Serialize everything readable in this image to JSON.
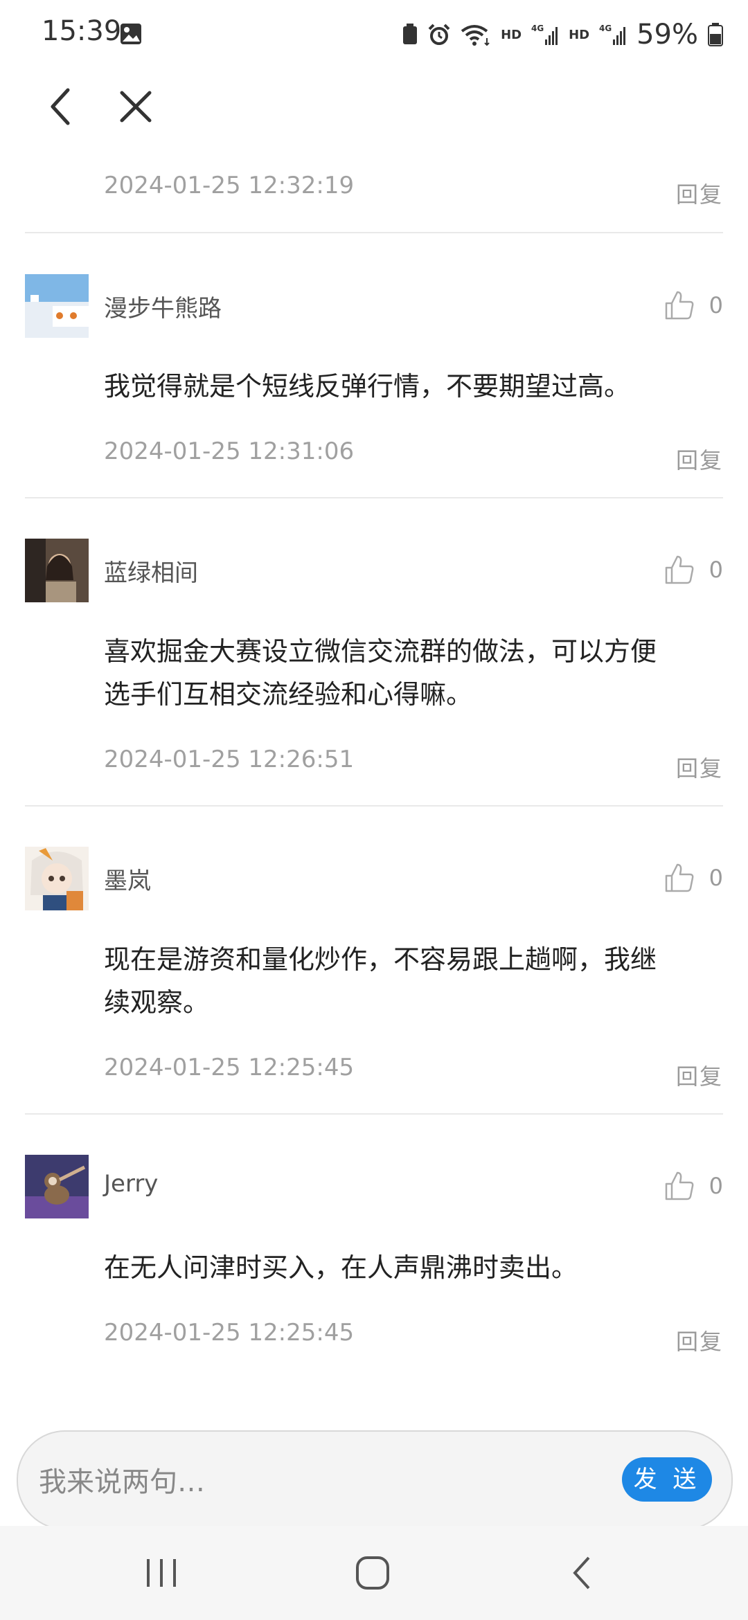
{
  "status_bar": {
    "time": "15:39",
    "battery": "59%",
    "signal_hd_1": "HD",
    "signal_4g_1": "4G",
    "signal_hd_2": "HD",
    "signal_4g_2": "4G",
    "wifi_sub": "6"
  },
  "nav": {
    "back_icon": "back-icon",
    "close_icon": "close-icon"
  },
  "top_partial": {
    "timestamp": "2024-01-25 12:32:19",
    "reply": "回复"
  },
  "comments": [
    {
      "username": "漫步牛熊路",
      "likes": "0",
      "lines": [
        "我觉得就是个短线反弹行情，不要期望过高。"
      ],
      "timestamp": "2024-01-25 12:31:06",
      "reply": "回复"
    },
    {
      "username": "蓝绿相间",
      "likes": "0",
      "lines": [
        "喜欢掘金大赛设立微信交流群的做法，可以方便",
        "选手们互相交流经验和心得嘛。"
      ],
      "timestamp": "2024-01-25 12:26:51",
      "reply": "回复"
    },
    {
      "username": "墨岚",
      "likes": "0",
      "lines": [
        "现在是游资和量化炒作，不容易跟上趟啊，我继",
        "续观察。"
      ],
      "timestamp": "2024-01-25 12:25:45",
      "reply": "回复"
    },
    {
      "username": "Jerry",
      "likes": "0",
      "lines": [
        "在无人问津时买入，在人声鼎沸时卖出。"
      ],
      "timestamp": "2024-01-25 12:25:45",
      "reply": "回复"
    }
  ],
  "input": {
    "placeholder": "我来说两句…",
    "send_label": "发 送"
  },
  "colors": {
    "accent": "#1e88e5",
    "muted_text": "#a0a0a0",
    "divider": "#e9e9e9"
  }
}
